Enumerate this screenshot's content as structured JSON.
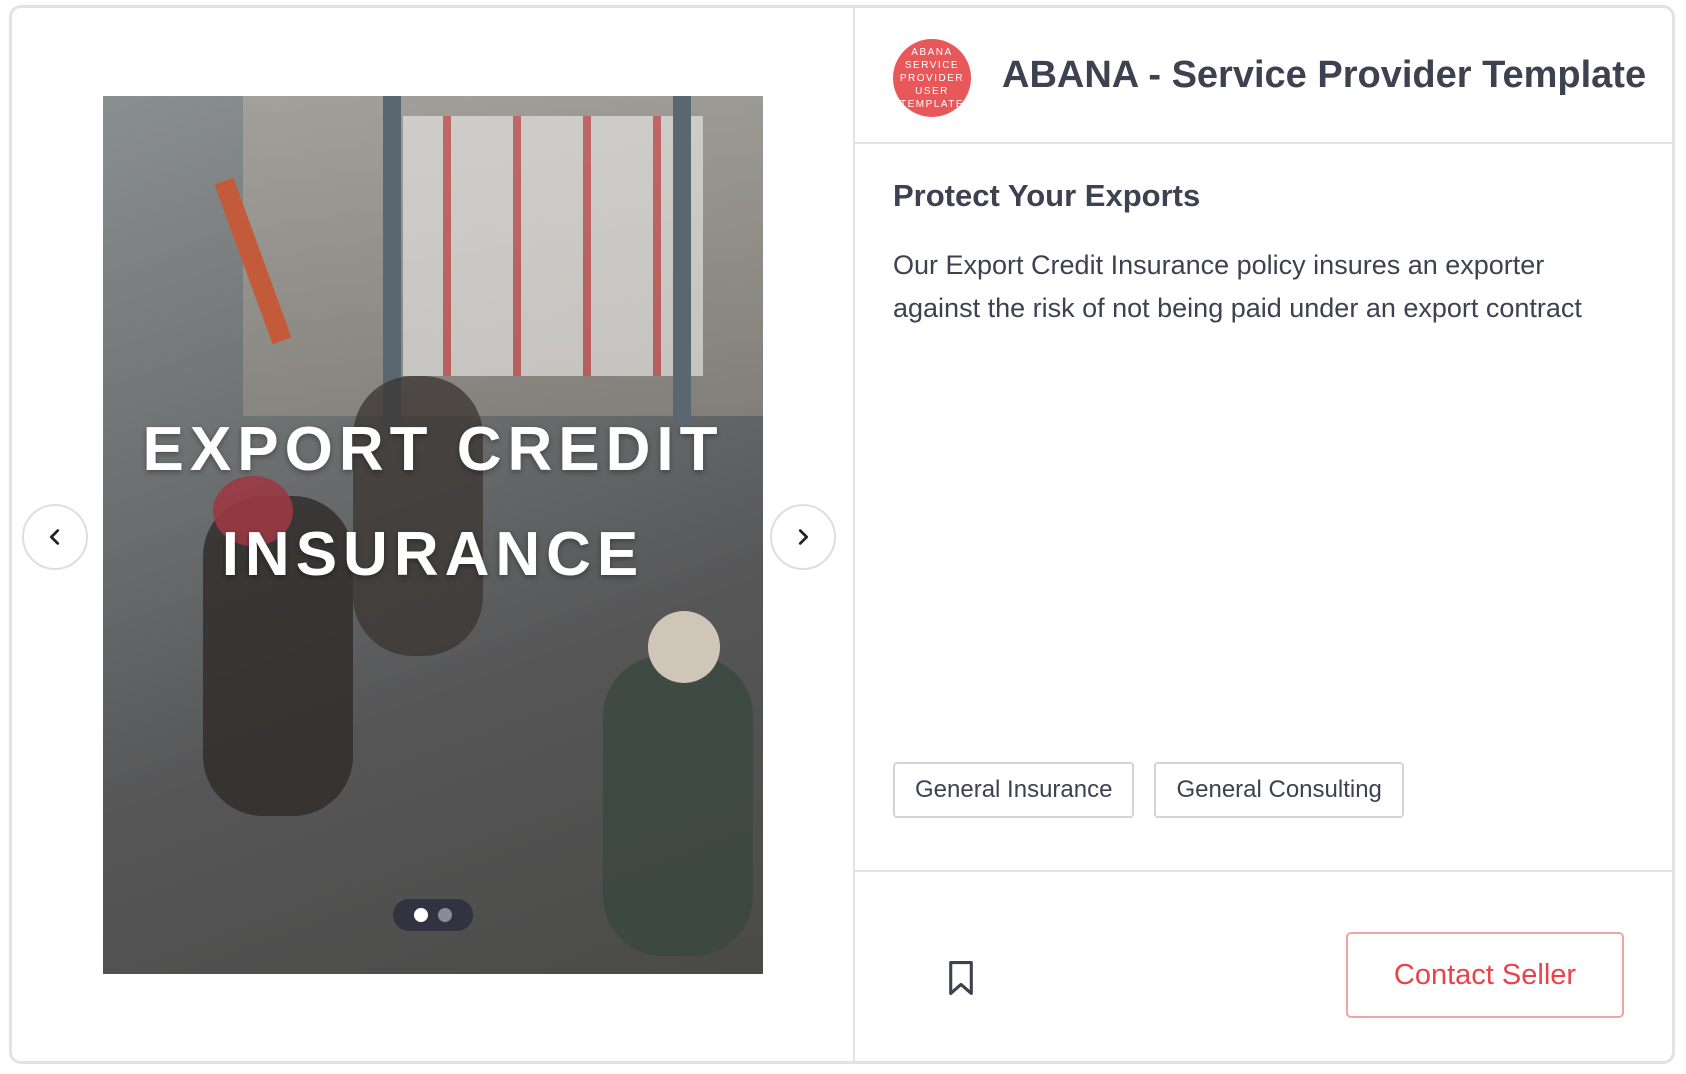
{
  "carousel": {
    "slide_title_line1": "EXPORT CREDIT",
    "slide_title_line2": "INSURANCE",
    "slide_count": 2,
    "active_slide": 1
  },
  "seller": {
    "logo_lines": [
      "ABANA",
      "SERVICE",
      "PROVIDER",
      "USER",
      "TEMPLATE"
    ],
    "name": "ABANA - Service Provider Template"
  },
  "product": {
    "title": "Protect Your Exports",
    "description": "Our Export Credit Insurance policy insures an exporter against the risk of not being paid under an export contract"
  },
  "tags": [
    "General Insurance",
    "General Consulting"
  ],
  "actions": {
    "contact_label": "Contact Seller"
  },
  "colors": {
    "accent": "#e8434b",
    "logo_bg": "#e8575a",
    "text": "#3e4150",
    "border": "#e3e3e6"
  },
  "icons": {
    "prev": "chevron-left-icon",
    "next": "chevron-right-icon",
    "bookmark": "bookmark-icon"
  }
}
